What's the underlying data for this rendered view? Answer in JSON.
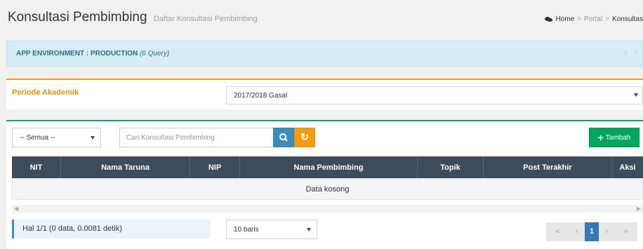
{
  "header": {
    "title": "Konsultasi Pembimbing",
    "subtitle": "Daftar Konsultasi Pembimbing",
    "breadcrumb": [
      "Home",
      "Portal",
      "Konsultas"
    ]
  },
  "env_alert": {
    "label": "APP ENVIRONMENT : PRODUCTION",
    "query": "(6 Query)",
    "chevron_icon": "chevron-down-icon",
    "close_icon": "close-icon"
  },
  "periode": {
    "label": "Periode Akademik",
    "value": "2017/2018 Gasal"
  },
  "toolbar": {
    "filter_value": "-- Semua --",
    "search_placeholder": "Cari Konsultasi Pembimbing",
    "add_label": "Tambah"
  },
  "table": {
    "columns": [
      "NIT",
      "Nama Taruna",
      "NIP",
      "Nama Pembimbing",
      "Topik",
      "Post Terakhir",
      "Aksi"
    ],
    "empty_text": "Data kosong"
  },
  "footer": {
    "page_info": "Hal 1/1 (0 data, 0.0081 detik)",
    "rows_value": "10 baris",
    "pagination": {
      "first": "«",
      "prev": "‹",
      "current": "1",
      "next": "›",
      "last": "»"
    }
  },
  "colors": {
    "accent_blue": "#3c8dbc",
    "accent_orange": "#f39c12",
    "accent_green": "#00a65a",
    "table_header": "#3d4c5c",
    "alert_bg": "#d7edf6"
  }
}
